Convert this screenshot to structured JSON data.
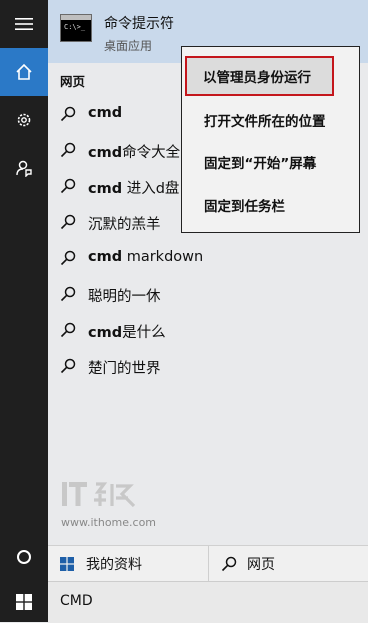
{
  "top_result": {
    "title": "命令提示符",
    "subtitle": "桌面应用",
    "thumb_text": "C:\\>_"
  },
  "section_label": "网页",
  "suggestions": [
    {
      "bold": "cmd",
      "rest": ""
    },
    {
      "bold": "cmd",
      "rest": "命令大全"
    },
    {
      "bold": "cmd",
      "rest": " 进入d盘"
    },
    {
      "bold": "",
      "rest": "沉默的羔羊"
    },
    {
      "bold": "cmd",
      "rest": " markdown"
    },
    {
      "bold": "",
      "rest": "聪明的一休"
    },
    {
      "bold": "cmd",
      "rest": "是什么"
    },
    {
      "bold": "",
      "rest": "楚门的世界"
    }
  ],
  "context_menu": {
    "items": [
      "以管理员身份运行",
      "打开文件所在的位置",
      "固定到“开始”屏幕",
      "固定到任务栏"
    ],
    "highlighted_index": 0
  },
  "watermark": {
    "logo": "IT之家",
    "url": "www.ithome.com"
  },
  "bottom_tabs": {
    "my_stuff": "我的资料",
    "web": "网页"
  },
  "search": {
    "value": "CMD"
  },
  "colors": {
    "accent": "#2b79c7",
    "rail": "#1f1f1f",
    "highlight_border": "#c4161c",
    "top_result_bg": "#c9d9eb"
  },
  "icons": [
    "hamburger-icon",
    "home-icon",
    "gear-icon",
    "feedback-icon",
    "cortana-circle-icon",
    "windows-logo-icon",
    "search-icon"
  ]
}
